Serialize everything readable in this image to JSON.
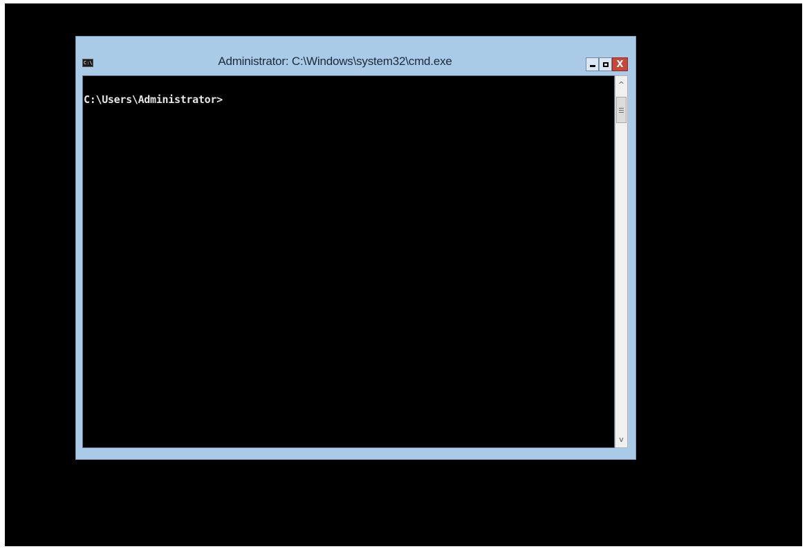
{
  "window": {
    "title": "Administrator: C:\\Windows\\system32\\cmd.exe",
    "icon": "cmd-app-icon",
    "icon_text": "C:\\",
    "controls": {
      "minimize_icon": "minimize-icon",
      "maximize_icon": "maximize-icon",
      "close_icon": "close-icon",
      "close_label": "X",
      "close_color": "#c7483b"
    }
  },
  "console": {
    "prompt": "C:\\Users\\Administrator>",
    "background": "#000000",
    "text_color": "#e6e6e6"
  },
  "scrollbar": {
    "up_arrow": "^",
    "down_arrow": "v"
  },
  "colors": {
    "frame": "#a9cbe7",
    "desktop": "#000000"
  }
}
